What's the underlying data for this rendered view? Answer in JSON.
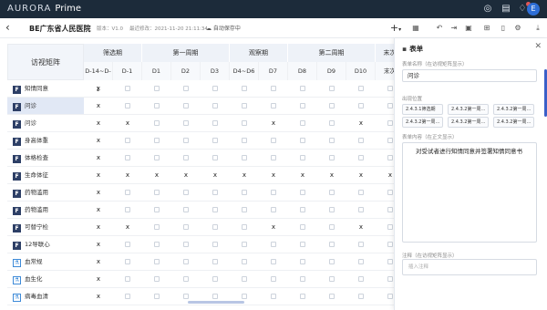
{
  "topbar": {
    "brand_aurora": "AURORA",
    "brand_prime": "Prime",
    "avatar_initial": "E",
    "icons": [
      "globe-icon",
      "file-icon",
      "bell-icon"
    ]
  },
  "subbar": {
    "project": "BE广东省人民医院",
    "version": "版本：V1.0",
    "saved": "最近修改：2021-11-20 21:11:34",
    "autosave": "自动保存中",
    "toolbar_icons": [
      "plus-icon",
      "grid-icon",
      "undo-icon",
      "export-icon",
      "calendar-icon",
      "layout-icon",
      "mobile-icon",
      "settings-icon",
      "download-icon"
    ]
  },
  "matrix": {
    "corner_label": "访视矩阵",
    "periods": [
      "筛选期",
      "第一周期",
      "观察期",
      "第二周期",
      "末次"
    ],
    "visits": [
      "D-14~D-1",
      "D-1",
      "D1",
      "D2",
      "D3",
      "D4~D6",
      "D7",
      "D8",
      "D9",
      "D10",
      "末次"
    ],
    "rows": [
      {
        "label": "知情同意",
        "type": "form",
        "marks": [
          1,
          0,
          0,
          0,
          0,
          0,
          0,
          0,
          0,
          0,
          0
        ]
      },
      {
        "label": "问诊",
        "type": "form",
        "marks": [
          1,
          0,
          0,
          0,
          0,
          0,
          0,
          0,
          0,
          0,
          0
        ],
        "selected": true
      },
      {
        "label": "问诊",
        "type": "form",
        "marks": [
          1,
          1,
          0,
          0,
          0,
          0,
          1,
          0,
          0,
          1,
          0
        ]
      },
      {
        "label": "身高体重",
        "type": "form",
        "marks": [
          1,
          0,
          0,
          0,
          0,
          0,
          0,
          0,
          0,
          0,
          0
        ]
      },
      {
        "label": "体格检查",
        "type": "form",
        "marks": [
          1,
          0,
          0,
          0,
          0,
          0,
          0,
          0,
          0,
          0,
          0
        ]
      },
      {
        "label": "生命体征",
        "type": "form",
        "marks": [
          1,
          1,
          1,
          1,
          1,
          1,
          1,
          1,
          1,
          1,
          1
        ]
      },
      {
        "label": "药物滥用",
        "type": "form",
        "marks": [
          1,
          0,
          0,
          0,
          0,
          0,
          0,
          0,
          0,
          0,
          0
        ]
      },
      {
        "label": "药物滥用",
        "type": "form",
        "marks": [
          1,
          0,
          0,
          0,
          0,
          0,
          0,
          0,
          0,
          0,
          0
        ]
      },
      {
        "label": "可替宁检",
        "type": "form",
        "marks": [
          1,
          1,
          0,
          0,
          0,
          0,
          1,
          0,
          0,
          1,
          0
        ]
      },
      {
        "label": "12导联心",
        "type": "form",
        "marks": [
          1,
          0,
          0,
          0,
          0,
          0,
          0,
          0,
          0,
          0,
          0
        ]
      },
      {
        "label": "血常规",
        "type": "lab",
        "marks": [
          1,
          0,
          0,
          0,
          0,
          0,
          0,
          0,
          0,
          0,
          0
        ]
      },
      {
        "label": "血生化",
        "type": "lab",
        "marks": [
          1,
          0,
          0,
          0,
          0,
          0,
          0,
          0,
          0,
          0,
          0
        ]
      },
      {
        "label": "病毒血清",
        "type": "lab",
        "marks": [
          1,
          0,
          0,
          0,
          0,
          0,
          0,
          0,
          0,
          0,
          0
        ]
      }
    ]
  },
  "panel": {
    "title": "表单",
    "name_label": "表单名称（在访视矩阵显示）",
    "name_value": "问诊",
    "location_label": "出现位置",
    "locations": [
      "2.4.3.1筛选期",
      "2.4.3.2第一周…",
      "2.4.3.2第一周…",
      "2.4.3.2第一周…",
      "2.4.3.2第一周…",
      "2.4.3.2第一周…"
    ],
    "content_label": "表单内容（在正文显示）",
    "content_text": "对受试者进行知情同意并签署知情同意书",
    "note_label": "注释（在访视矩阵显示）",
    "note_placeholder": "插入注释"
  }
}
